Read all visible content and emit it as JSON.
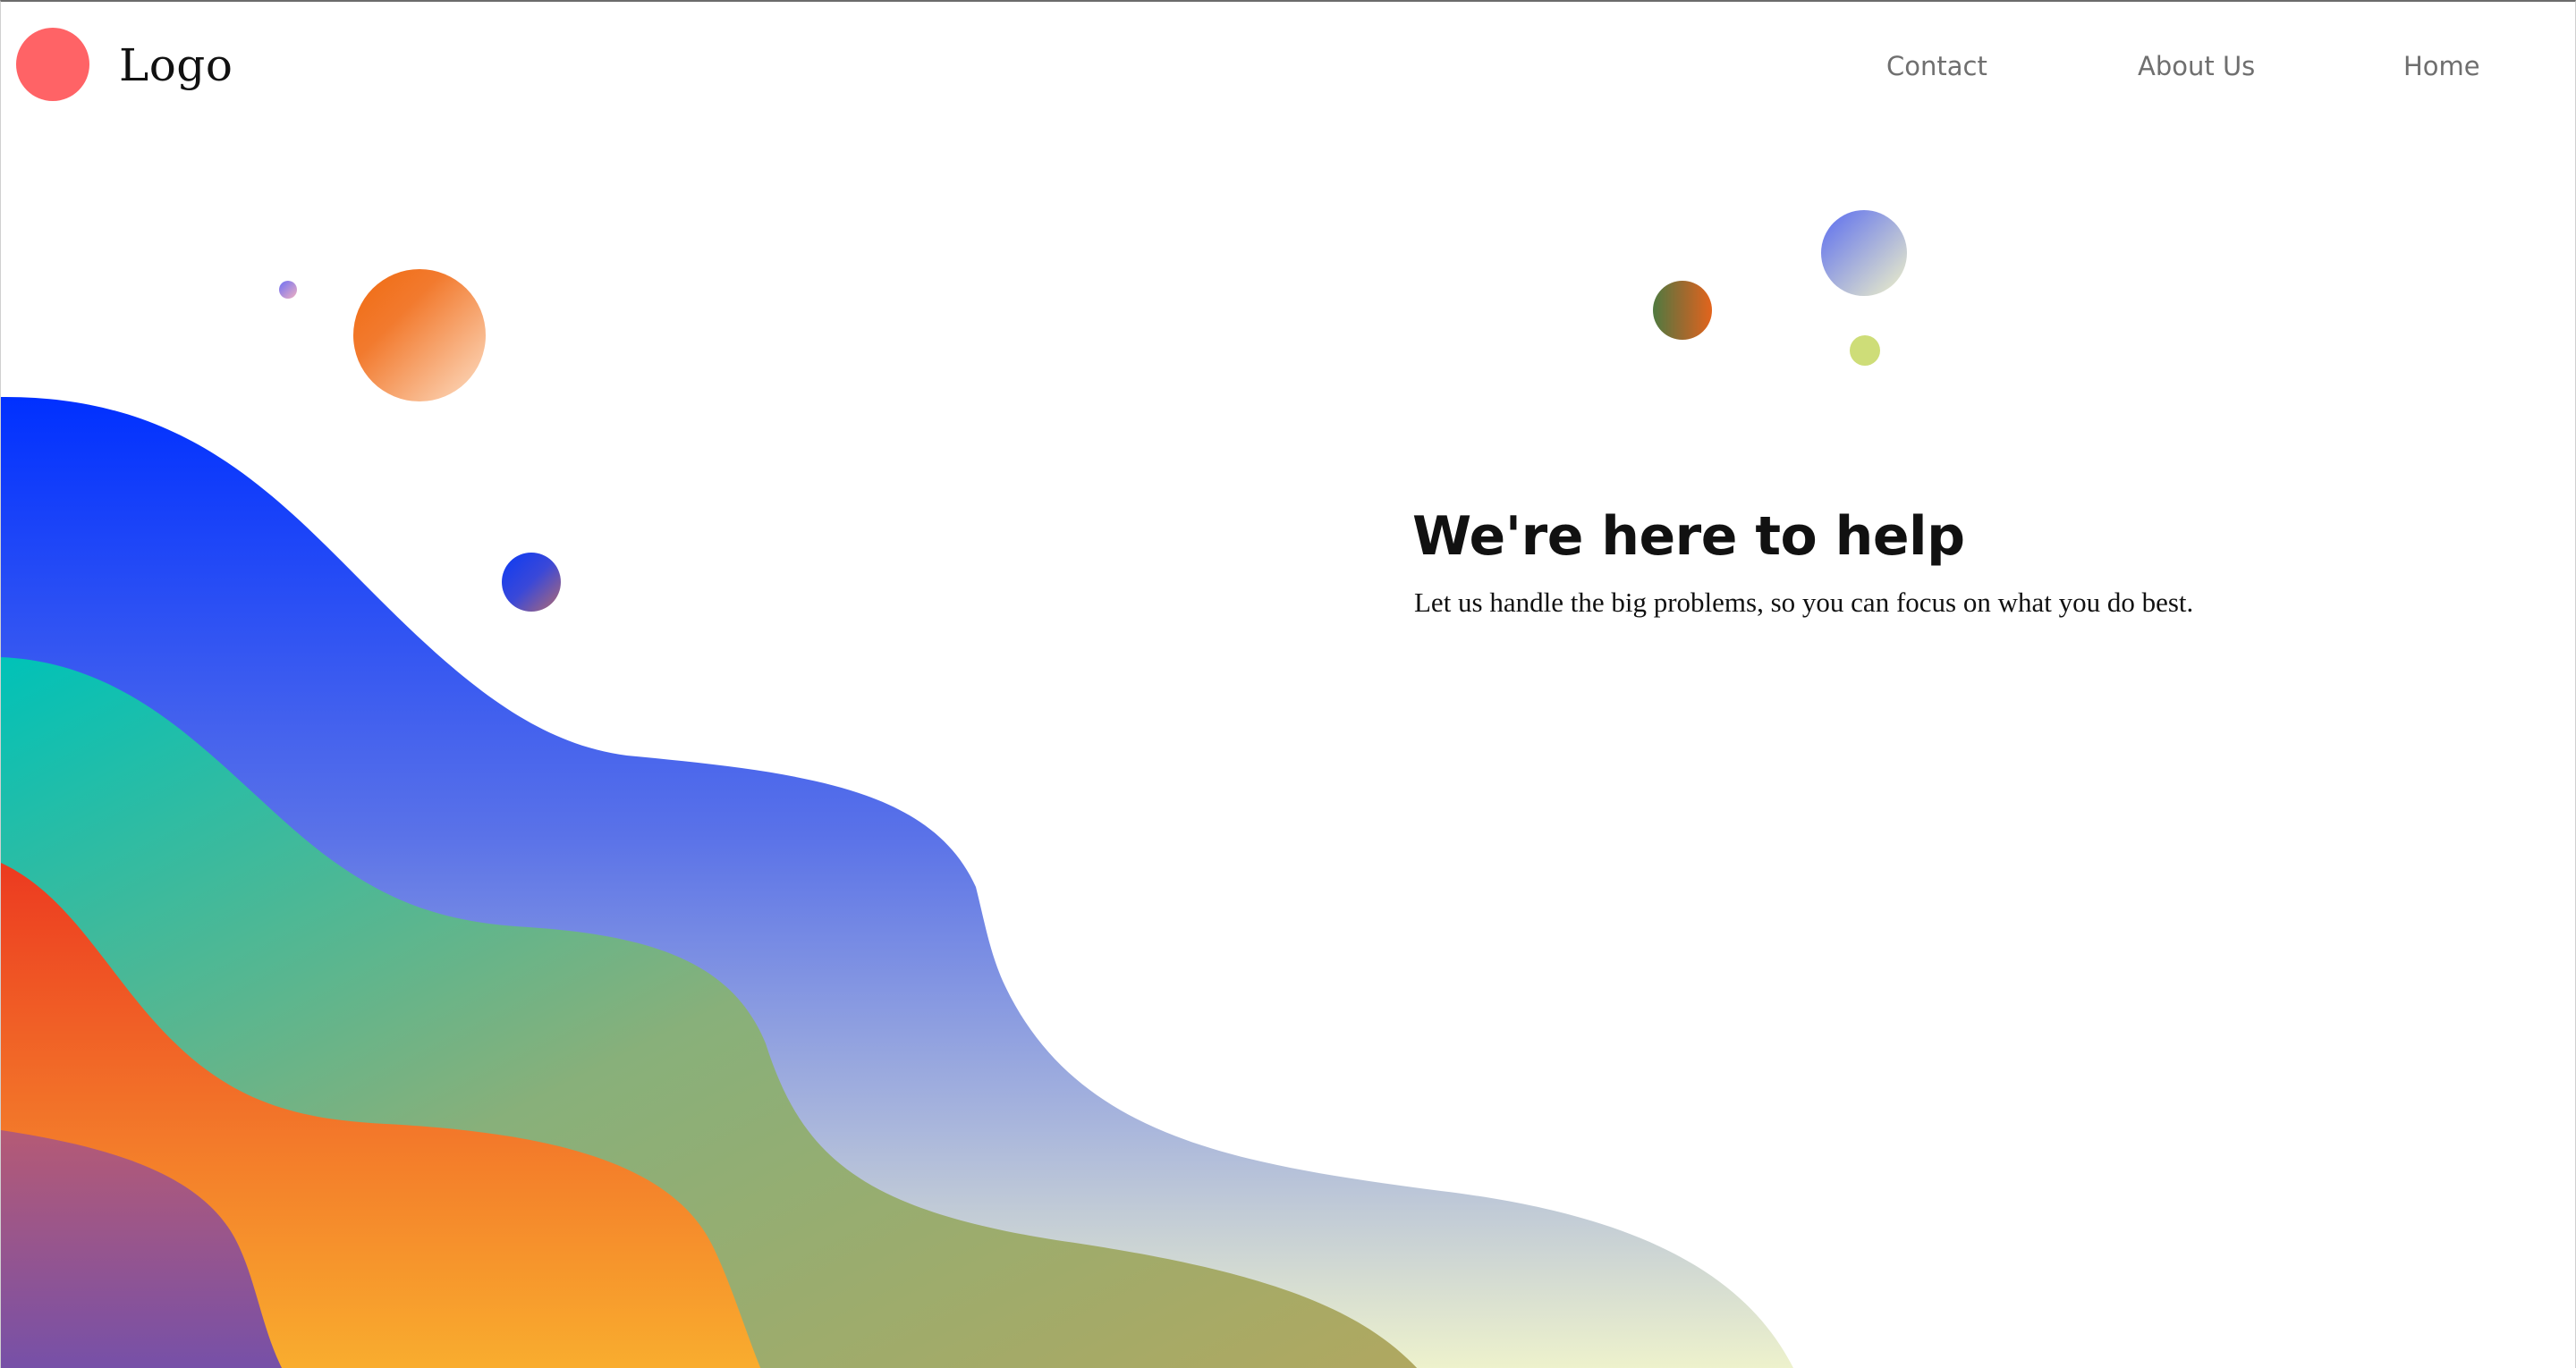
{
  "header": {
    "logo_text": "Logo",
    "nav": [
      {
        "label": "Contact"
      },
      {
        "label": "About Us"
      },
      {
        "label": "Home"
      }
    ]
  },
  "hero": {
    "title": "We're here to help",
    "subtitle": "Let us handle the big problems, so you can focus on what you do best."
  },
  "colors": {
    "logo_mark": "#ff6366",
    "wave_blue": [
      "#0030ff",
      "#e8f1c8"
    ],
    "wave_teal": [
      "#00c2b8",
      "#a8a85c"
    ],
    "wave_orange": [
      "#ef3d22",
      "#f9a82c"
    ],
    "wave_purple": [
      "#b05a78",
      "#7a52a8"
    ]
  }
}
